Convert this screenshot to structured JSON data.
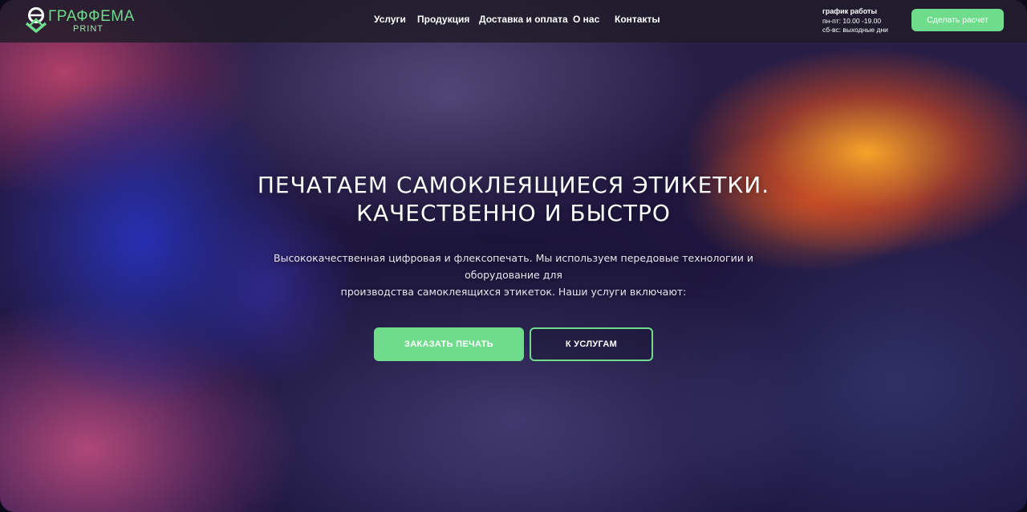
{
  "brand": {
    "name": "ГРАФФЕМА",
    "sub": "PRINT",
    "accent": "#6fdc8c"
  },
  "nav": [
    {
      "label": "Услуги"
    },
    {
      "label": "Продукция"
    },
    {
      "label": "Доставка и оплата"
    },
    {
      "label": "О нас"
    },
    {
      "label": "Контакты"
    }
  ],
  "schedule": {
    "title": "график работы",
    "weekdays": "пн-пт: 10.00 -19.00",
    "weekend": "сб-вс: выходные дни"
  },
  "header": {
    "cta_label": "Сделать расчет"
  },
  "hero": {
    "title_line1": "ПЕЧАТАЕМ САМОКЛЕЯЩИЕСЯ ЭТИКЕТКИ.",
    "title_line2": "КАЧЕСТВЕННО И БЫСТРО",
    "subtitle_line1": "Высококачественная цифровая и флексопечать. Мы используем передовые технологии и оборудование для",
    "subtitle_line2": "производства самоклеящихся этикеток. Наши услуги включают:",
    "primary_button": "ЗАКАЗАТЬ ПЕЧАТЬ",
    "secondary_button": "К УСЛУГАМ"
  }
}
